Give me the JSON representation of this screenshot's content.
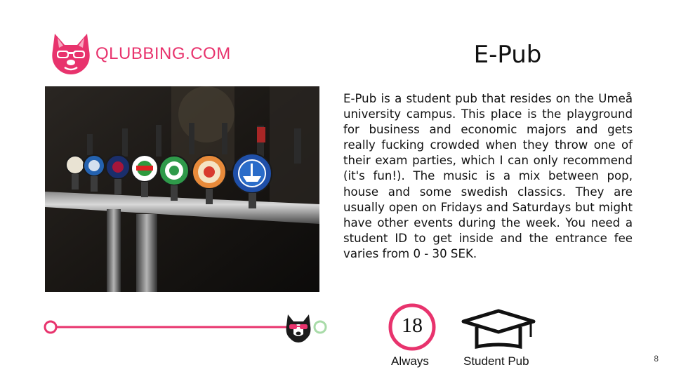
{
  "brand": {
    "logo_text": "QLUBBING.COM",
    "accent_color": "#e8336d",
    "logo_icon": "bulldog-sunglasses-icon"
  },
  "slide": {
    "title": "E-Pub",
    "description": "E-Pub is a student pub that resides on the Umeå university campus. This place is the playground for business and economic majors and gets really fucking crowded when they throw one of their exam parties, which I can only recommend (it's fun!). The music is a mix between pop, house and some swedish classics. They are usually open on Fridays and Saturdays but might have other events during the week. You need a student ID to get inside and the entrance fee varies from 0 - 30 SEK.",
    "photo_subject": "beer taps at the bar",
    "page_number": "8"
  },
  "timeline": {
    "line_color": "#e8336d",
    "end_circle_color": "#a8dba8",
    "marker_icon": "bulldog-sunglasses-icon"
  },
  "badges": {
    "age": {
      "number": "18",
      "caption": "Always",
      "icon": "age-limit-circle-icon",
      "color": "#e8336d"
    },
    "type": {
      "caption": "Student Pub",
      "icon": "graduation-cap-icon"
    }
  }
}
